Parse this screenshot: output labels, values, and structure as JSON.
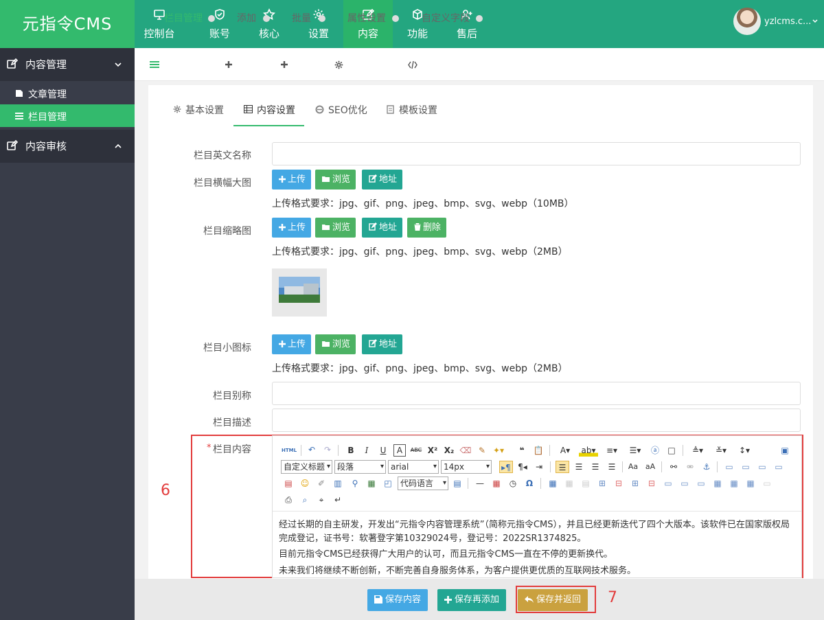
{
  "app": {
    "logo": "元指令CMS",
    "user_name": "yzlcms.c..."
  },
  "nav": [
    {
      "label": "控制台",
      "icon": "monitor-icon"
    },
    {
      "label": "账号",
      "icon": "shield-icon"
    },
    {
      "label": "核心",
      "icon": "star-icon"
    },
    {
      "label": "设置",
      "icon": "gear-icon"
    },
    {
      "label": "内容",
      "icon": "edit-icon",
      "active": true
    },
    {
      "label": "功能",
      "icon": "cube-icon"
    },
    {
      "label": "售后",
      "icon": "user-plus-icon"
    }
  ],
  "sidebar": {
    "group1": "内容管理",
    "items": [
      {
        "label": "文章管理"
      },
      {
        "label": "栏目管理",
        "active": true
      }
    ],
    "group2": "内容审核"
  },
  "breadcrumb": [
    "栏目管理",
    "添加",
    "批量",
    "属性设置",
    "自定义字段"
  ],
  "tabs": [
    "基本设置",
    "内容设置",
    "SEO优化",
    "模板设置"
  ],
  "form": {
    "en_name_label": "栏目英文名称",
    "banner_label": "栏目横幅大图",
    "thumb_label": "栏目缩略图",
    "icon_label": "栏目小图标",
    "alias_label": "栏目别称",
    "desc_label": "栏目描述",
    "content_label": "栏目内容",
    "required_mark": "*",
    "btn_upload": "上传",
    "btn_browse": "浏览",
    "btn_address": "地址",
    "btn_delete": "删除",
    "hint_10mb": "上传格式要求：jpg、gif、png、jpeg、bmp、svg、webp（10MB）",
    "hint_2mb": "上传格式要求：jpg、gif、png、jpeg、bmp、svg、webp（2MB）"
  },
  "editor": {
    "toolbar": {
      "html": "HTML",
      "custom_title": "自定义标题",
      "paragraph": "段落",
      "font": "arial",
      "size": "14px",
      "code_lang": "代码语言"
    },
    "content": [
      "经过长期的自主研发，开发出“元指令内容管理系统”（简称元指令CMS），并且已经更新迭代了四个大版本。该软件已在国家版权局完成登记，证书号：软著登字第10329024号，登记号：2022SR1374825。",
      "目前元指令CMS已经获得广大用户的认可，而且元指令CMS一直在不停的更新换代。",
      "未来我们将继续不断创新，不断完善自身服务体系，为客户提供更优质的互联网技术服务。"
    ]
  },
  "footer": {
    "save": "保存内容",
    "save_add": "保存再添加",
    "save_return": "保存并返回"
  },
  "annotations": {
    "a6": "6",
    "a7": "7"
  },
  "colors": {
    "header": "#24a680",
    "logo_bg": "#33ba6d",
    "sidebar": "#393d49",
    "accent": "#33ba6d",
    "annotation": "#e23b3b"
  }
}
